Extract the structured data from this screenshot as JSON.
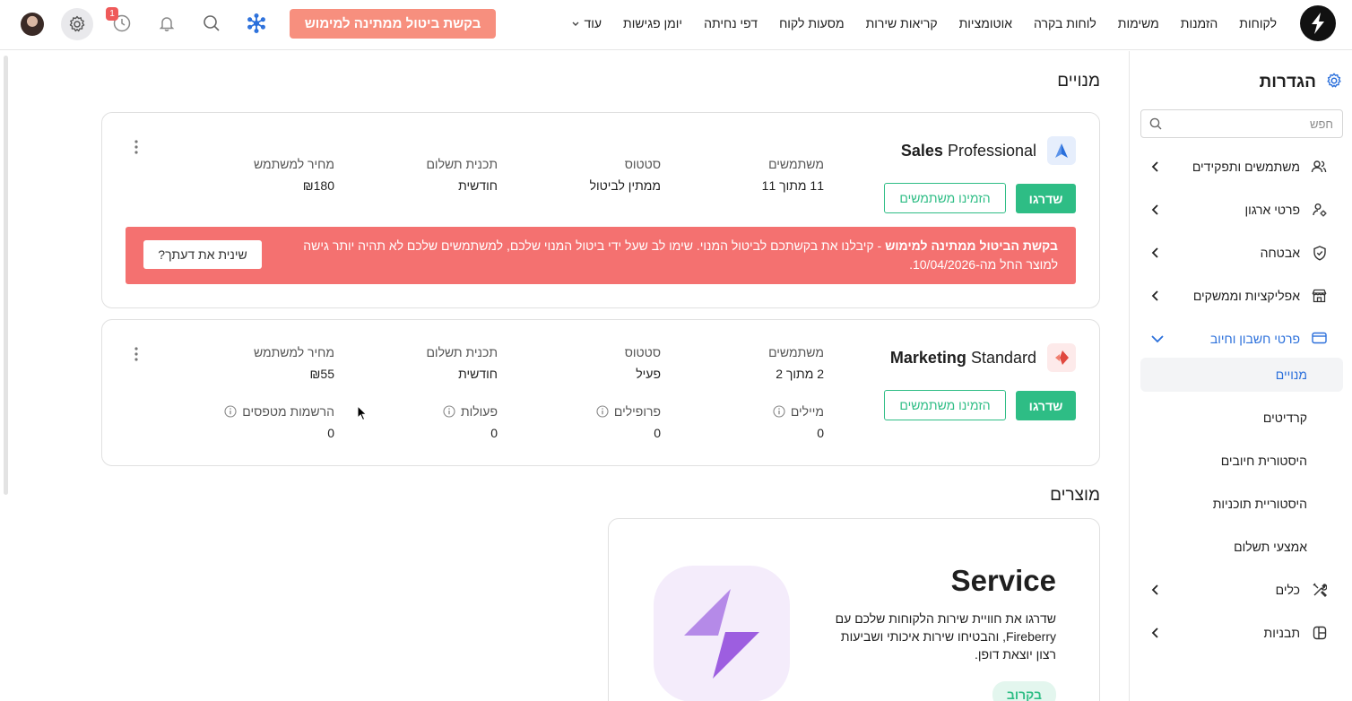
{
  "nav": {
    "links": [
      "לקוחות",
      "הזמנות",
      "משימות",
      "לוחות בקרה",
      "אוטומציות",
      "קריאות שירות",
      "מסעות לקוח",
      "דפי נחיתה",
      "יומן פגישות"
    ],
    "more_label": "עוד",
    "cancel_request_button": "בקשת ביטול ממתינה למימוש",
    "notification_count": "1"
  },
  "sidebar": {
    "title": "הגדרות",
    "search_placeholder": "חפש",
    "items": [
      {
        "label": "משתמשים ותפקידים",
        "icon": "users-icon"
      },
      {
        "label": "פרטי ארגון",
        "icon": "org-icon"
      },
      {
        "label": "אבטחה",
        "icon": "shield-icon"
      },
      {
        "label": "אפליקציות וממשקים",
        "icon": "store-icon"
      },
      {
        "label": "פרטי חשבון וחיוב",
        "icon": "credit-card-icon"
      }
    ],
    "billing_sub": [
      "מנויים",
      "קרדיטים",
      "היסטורית חיובים",
      "היסטוריית תוכניות",
      "אמצעי תשלום"
    ],
    "items_after": [
      {
        "label": "כלים",
        "icon": "tools-icon"
      },
      {
        "label": "תבניות",
        "icon": "templates-icon"
      }
    ]
  },
  "main": {
    "subscriptions_title": "מנויים",
    "products_title": "מוצרים",
    "plans": [
      {
        "name_bold": "Sales",
        "name_rest": " Professional",
        "upgrade": "שדרגו",
        "invite": "הזמינו משתמשים",
        "users_h": "משתמשים",
        "users_v": "11 מתוך 11",
        "status_h": "סטטוס",
        "status_v": "ממתין לביטול",
        "plan_h": "תכנית תשלום",
        "plan_v": "חודשית",
        "price_h": "מחיר למשתמש",
        "price_v": "₪180",
        "alert_bold": "בקשת הביטול ממתינה למימוש",
        "alert_text": " - קיבלנו את בקשתכם לביטול המנוי. שימו לב שעל ידי ביטול המנוי שלכם, למשתמשים שלכם לא תהיה יותר גישה למוצר החל מה-10/04/2026.",
        "alert_button": "שינית את דעתך?"
      },
      {
        "name_bold": "Marketing",
        "name_rest": " Standard",
        "upgrade": "שדרגו",
        "invite": "הזמינו משתמשים",
        "users_h": "משתמשים",
        "users_v": "2 מתוך 2",
        "status_h": "סטטוס",
        "status_v": "פעיל",
        "plan_h": "תכנית תשלום",
        "plan_v": "חודשית",
        "price_h": "מחיר למשתמש",
        "price_v": "₪55",
        "emails_h": "מיילים",
        "emails_v": "0",
        "profiles_h": "פרופילים",
        "profiles_v": "0",
        "actions_h": "פעולות",
        "actions_v": "0",
        "forms_h": "הרשמות מטפסים",
        "forms_v": "0"
      }
    ],
    "product": {
      "title": "Service",
      "description": "שדרגו את חוויית שירות הלקוחות שלכם עם Fireberry, והבטיחו שירות איכותי ושביעות רצון יוצאת דופן.",
      "soon": "בקרוב"
    }
  },
  "colors": {
    "accent_green": "#2ebd85",
    "alert_red": "#f47170",
    "cancel_button": "#f78f7e",
    "link_blue": "#2a6fdb"
  }
}
